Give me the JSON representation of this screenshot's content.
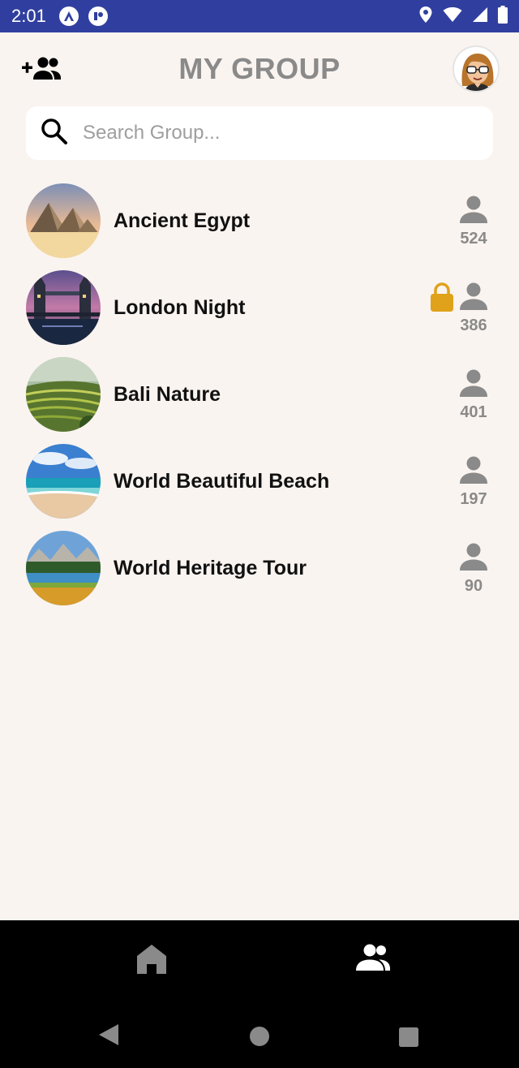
{
  "status_bar": {
    "time": "2:01"
  },
  "header": {
    "title": "MY GROUP"
  },
  "search": {
    "placeholder": "Search Group..."
  },
  "groups": [
    {
      "name": "Ancient Egypt",
      "members": "524",
      "locked": false
    },
    {
      "name": "London Night",
      "members": "386",
      "locked": true
    },
    {
      "name": "Bali Nature",
      "members": "401",
      "locked": false
    },
    {
      "name": "World Beautiful Beach",
      "members": "197",
      "locked": false
    },
    {
      "name": "World Heritage Tour",
      "members": "90",
      "locked": false
    }
  ],
  "colors": {
    "status_bar": "#303f9f",
    "background": "#faf4f0",
    "title": "#8a8a8a",
    "lock": "#e0a21a",
    "member_icon": "#8a8a8a"
  },
  "icons": {
    "add_group": "group-add-icon",
    "search": "search-icon",
    "member": "person-icon",
    "lock": "lock-icon",
    "nav_home": "home-icon",
    "nav_groups": "groups-icon"
  }
}
